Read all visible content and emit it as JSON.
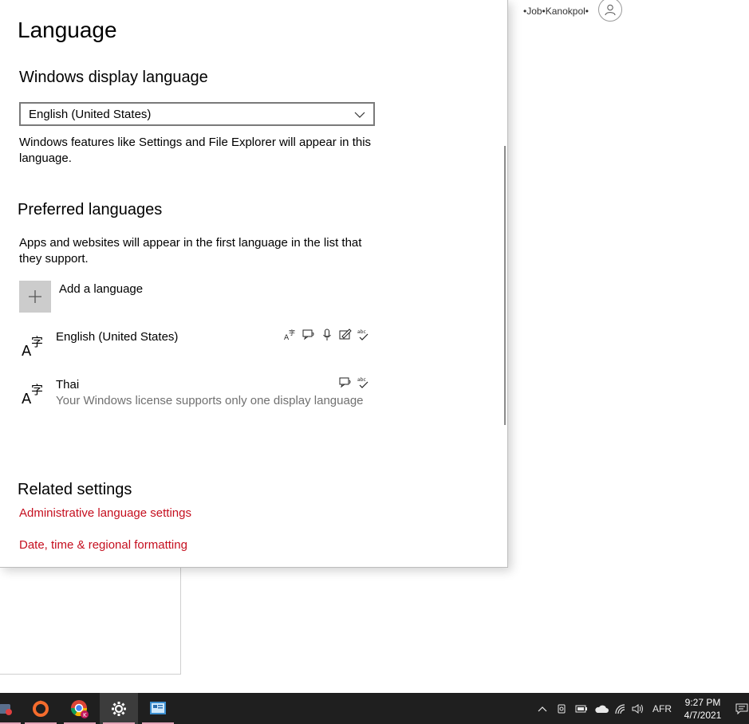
{
  "header": {
    "user_text": "•Job•Kanokpol•"
  },
  "panel": {
    "title": "Language",
    "display_language": {
      "heading": "Windows display language",
      "selected": "English (United States)",
      "description": "Windows features like Settings and File Explorer will appear in this language."
    },
    "preferred": {
      "heading": "Preferred languages",
      "description": "Apps and websites will appear in the first language in the list that they support.",
      "add_label": "Add a language",
      "languages": [
        {
          "name": "English (United States)",
          "subtitle": "",
          "features": [
            "display-language-icon",
            "text-to-speech-icon",
            "speech-icon",
            "handwriting-icon",
            "spellcheck-icon"
          ]
        },
        {
          "name": "Thai",
          "subtitle": "Your Windows license supports only one display language",
          "features": [
            "text-to-speech-icon",
            "spellcheck-icon"
          ]
        }
      ]
    },
    "related": {
      "heading": "Related settings",
      "links": [
        "Administrative language settings",
        "Date, time & regional formatting"
      ]
    }
  },
  "taskbar": {
    "apps": [
      "explorer-icon",
      "origin-icon",
      "chrome-icon",
      "settings-icon",
      "control-panel-icon"
    ],
    "active_app": "settings-icon",
    "input_language": "AFR",
    "time": "9:27 PM",
    "date": "4/7/2021"
  },
  "colors": {
    "accent_link": "#c50f1f",
    "taskbar": "#1f1f1f"
  }
}
